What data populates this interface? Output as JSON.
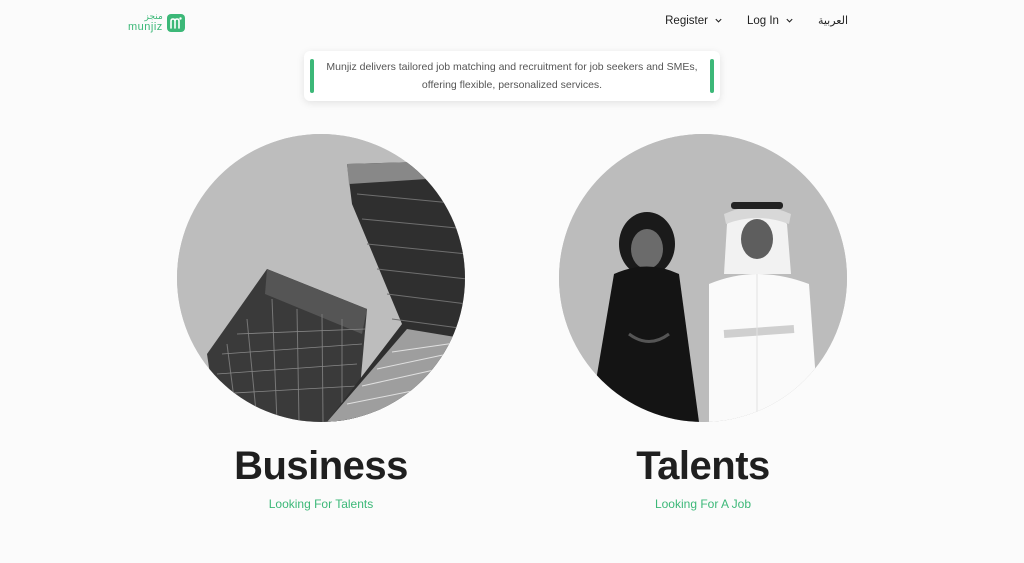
{
  "header": {
    "logo_ar": "منجز",
    "logo_en": "munjiz",
    "logo_mark": "m",
    "nav": {
      "register": "Register",
      "login": "Log In",
      "language": "العربية"
    }
  },
  "banner": {
    "text": "Munjiz delivers tailored job matching and recruitment for job seekers and SMEs, offering flexible, personalized services."
  },
  "cards": {
    "business": {
      "title": "Business",
      "subtitle": "Looking For Talents",
      "image": "office-buildings"
    },
    "talents": {
      "title": "Talents",
      "subtitle": "Looking For A Job",
      "image": "two-people"
    }
  },
  "colors": {
    "accent": "#3cb878",
    "text": "#1f1f1f",
    "background": "#fbfbfb"
  },
  "icons": [
    "chevron-down-icon",
    "logo-mark-icon"
  ]
}
